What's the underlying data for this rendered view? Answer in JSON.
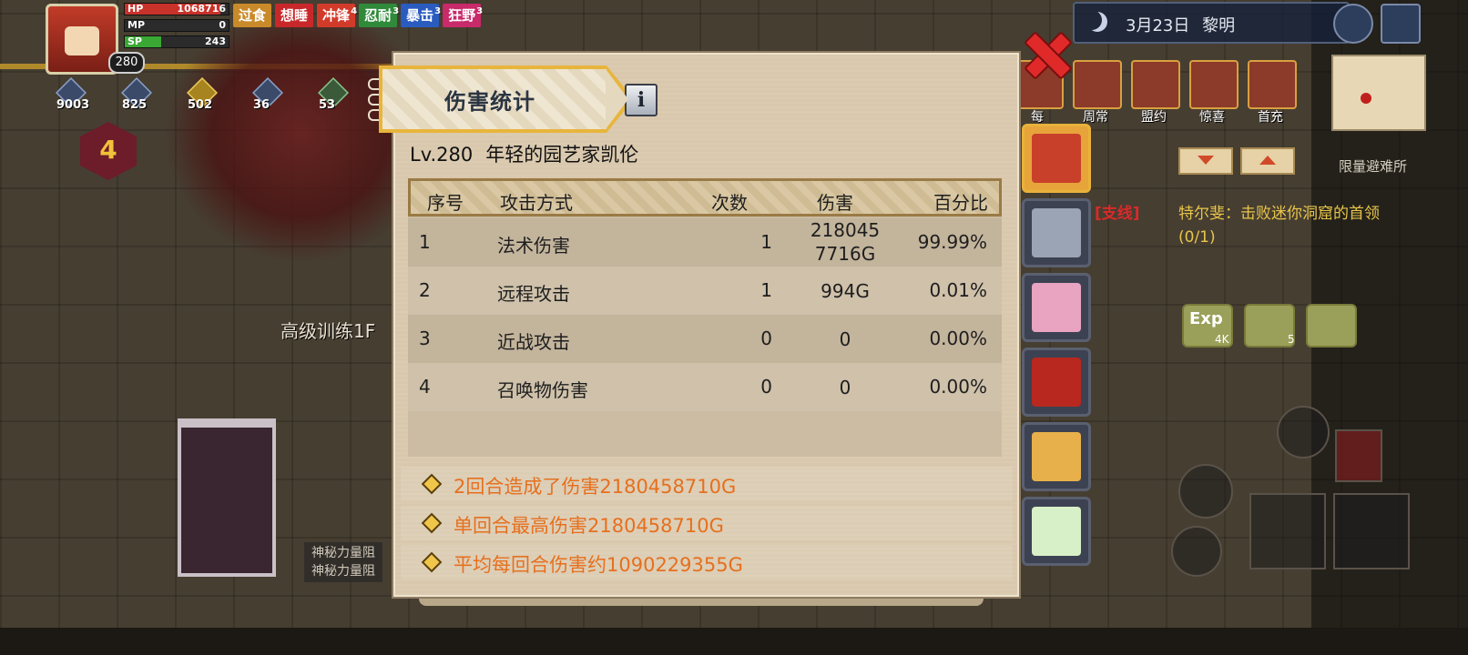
{
  "hud": {
    "level": "280",
    "hp": {
      "label": "HP",
      "value": "1068716",
      "fill": 0.92,
      "color": "#c8322a"
    },
    "mp": {
      "label": "MP",
      "value": "0",
      "fill": 0.0,
      "color": "#2a5ec8"
    },
    "sp": {
      "label": "SP",
      "value": "243",
      "fill": 0.35,
      "color": "#3aa834"
    },
    "buffs": [
      {
        "label": "过食",
        "count": "",
        "color": "#c98a2a"
      },
      {
        "label": "想睡",
        "count": "",
        "color": "#c8282a"
      },
      {
        "label": "冲锋",
        "count": "4",
        "color": "#d23b2a"
      },
      {
        "label": "忍耐",
        "count": "3",
        "color": "#2f8a3a"
      },
      {
        "label": "暴击",
        "count": "3",
        "color": "#2a5cc0"
      },
      {
        "label": "狂野",
        "count": "3",
        "color": "#c82a6a"
      }
    ],
    "resources": [
      "9003",
      "825",
      "502",
      "36",
      "53",
      "4"
    ],
    "floor_level": "4",
    "location": "高级训练1F",
    "mystic_lines": [
      "神秘力量阻",
      "神秘力量阻"
    ]
  },
  "topright": {
    "date": "3月23日",
    "time_of_day": "黎明",
    "events": [
      "每",
      "周常",
      "盟约",
      "惊喜",
      "首充"
    ],
    "refuge": "限量避难所",
    "quest_tag": "[支线]",
    "quest_text": "特尔斐：击败迷你洞窟的首领",
    "quest_progress": "(0/1)",
    "exp_label": "Exp",
    "exp_value": "4K",
    "slot_value": "5"
  },
  "panel": {
    "title": "伤害统计",
    "info_label": "i",
    "level": "Lv.280",
    "character_name": "年轻的园艺家凯伦",
    "headers": {
      "index": "序号",
      "type": "攻击方式",
      "count": "次数",
      "damage": "伤害",
      "percent": "百分比"
    },
    "rows": [
      {
        "index": "1",
        "type": "法术伤害",
        "count": "1",
        "damage": "2180457716G",
        "damage_line1": "218045",
        "damage_line2": "7716G",
        "percent": "99.99%"
      },
      {
        "index": "2",
        "type": "远程攻击",
        "count": "1",
        "damage": "994G",
        "percent": "0.01%"
      },
      {
        "index": "3",
        "type": "近战攻击",
        "count": "0",
        "damage": "0",
        "percent": "0.00%"
      },
      {
        "index": "4",
        "type": "召唤物伤害",
        "count": "0",
        "damage": "0",
        "percent": "0.00%"
      }
    ],
    "summary": [
      "2回合造成了伤害2180458710G",
      "单回合最高伤害2180458710G",
      "平均每回合伤害约1090229355G"
    ]
  },
  "party": [
    {
      "name": "party-member-gardener",
      "color": "#c8402a",
      "active": true
    },
    {
      "name": "party-member-mech-dragon",
      "color": "#9aa4b4",
      "active": false
    },
    {
      "name": "party-member-pink-nurse",
      "color": "#e8a4c0",
      "active": false
    },
    {
      "name": "party-member-witch",
      "color": "#b8281e",
      "active": false
    },
    {
      "name": "party-member-blonde-girl",
      "color": "#e8b04a",
      "active": false
    },
    {
      "name": "party-member-antler-spirit",
      "color": "#d8f0c8",
      "active": false
    }
  ],
  "colors": {
    "accent": "#e8b53c",
    "summary_text": "#e6701e",
    "close": "#e02a2a"
  }
}
